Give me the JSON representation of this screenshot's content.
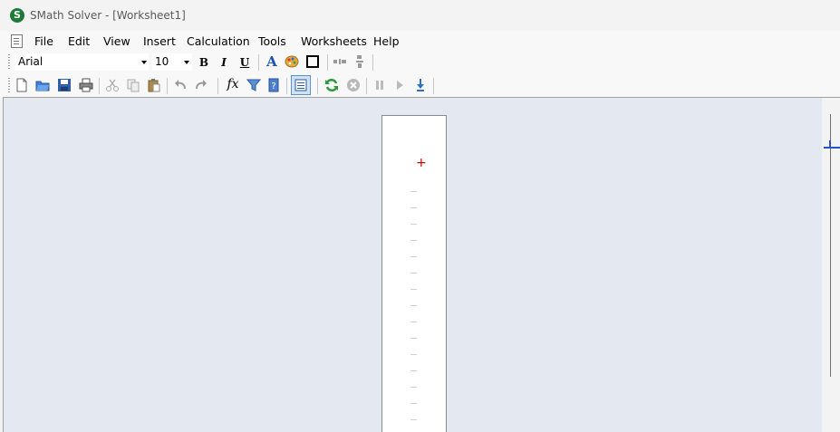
{
  "window": {
    "title": "SMath Solver - [Worksheet1]",
    "app_icon_letter": "S"
  },
  "menu": {
    "items": [
      "File",
      "Edit",
      "View",
      "Insert",
      "Calculation",
      "Tools",
      "Worksheets",
      "Help"
    ]
  },
  "format_toolbar": {
    "font_name": "Arial",
    "font_size": "10",
    "bold_label": "B",
    "italic_label": "I",
    "underline_label": "U",
    "text_color_label": "A"
  },
  "standard_toolbar": {
    "function_label": "fx"
  },
  "colors": {
    "canvas_bg": "#e4e8f0",
    "cursor": "#c00000",
    "ruler_marker": "#2a4fd0",
    "app_icon": "#1f7a3a"
  }
}
